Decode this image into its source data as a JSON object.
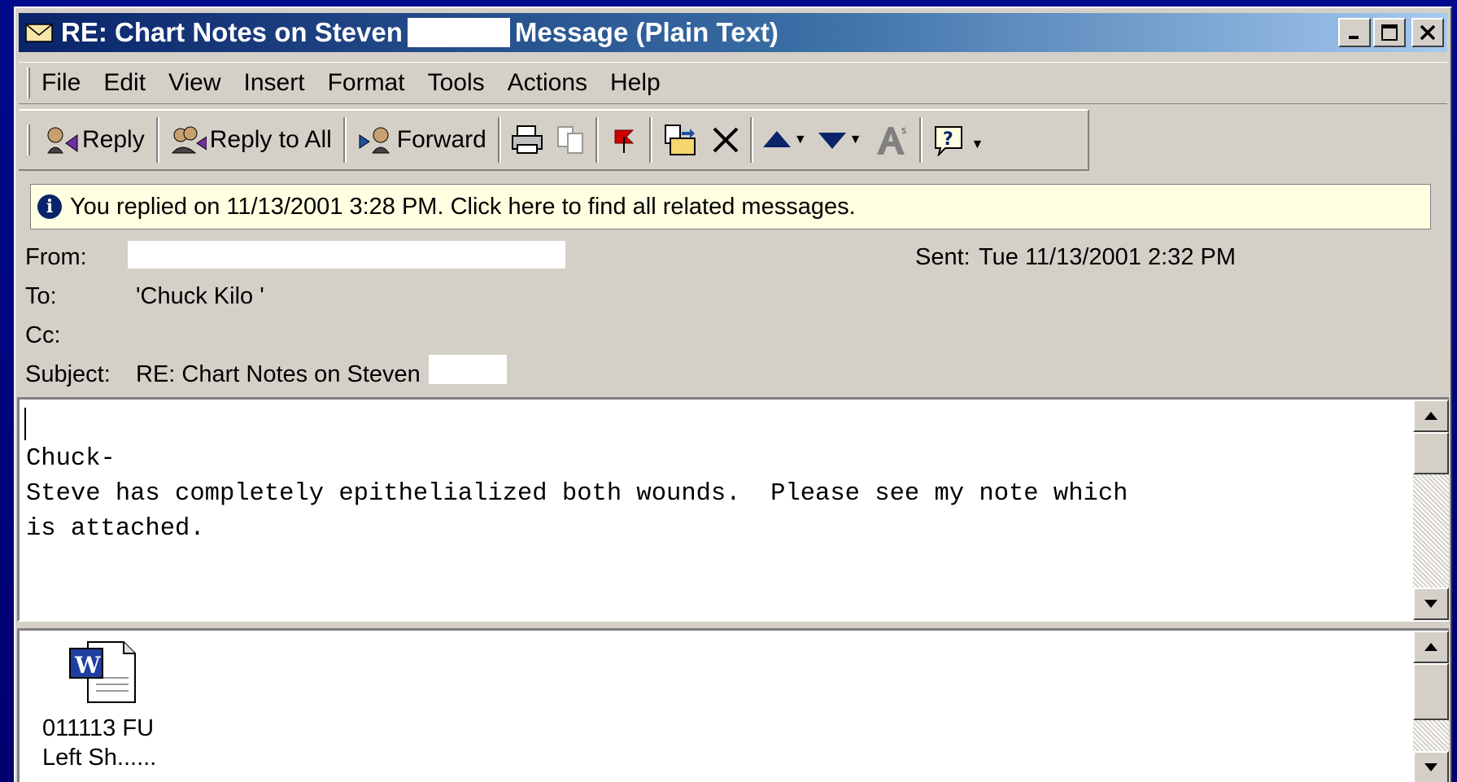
{
  "window": {
    "title_prefix": "RE: Chart Notes on Steven",
    "title_suffix": "Message (Plain Text)",
    "controls": {
      "minimize": "_",
      "maximize": "□",
      "close": "✕"
    }
  },
  "menu": [
    "File",
    "Edit",
    "View",
    "Insert",
    "Format",
    "Tools",
    "Actions",
    "Help"
  ],
  "toolbar": {
    "reply": "Reply",
    "reply_all": "Reply to All",
    "forward": "Forward"
  },
  "infobar": {
    "text": "You replied on 11/13/2001 3:28 PM. Click here to find all related messages."
  },
  "header": {
    "from_label": "From:",
    "to_label": "To:",
    "to_value": "'Chuck Kilo '",
    "cc_label": "Cc:",
    "subject_label": "Subject:",
    "subject_value": "RE: Chart Notes on Steven",
    "sent_label": "Sent:",
    "sent_value": "Tue 11/13/2001 2:32 PM"
  },
  "body": {
    "line1": "Chuck-",
    "line2": "Steve has completely epithelialized both wounds.  Please see my note which",
    "line3": "is attached."
  },
  "attachment": {
    "name_line1": "011113 FU",
    "name_line2": "Left Sh......"
  },
  "colors": {
    "background": "#000a8c",
    "window": "#d4d0c8",
    "titlebar_start": "#0a246a",
    "titlebar_end": "#a6caf0",
    "infobar": "#ffffe1"
  }
}
